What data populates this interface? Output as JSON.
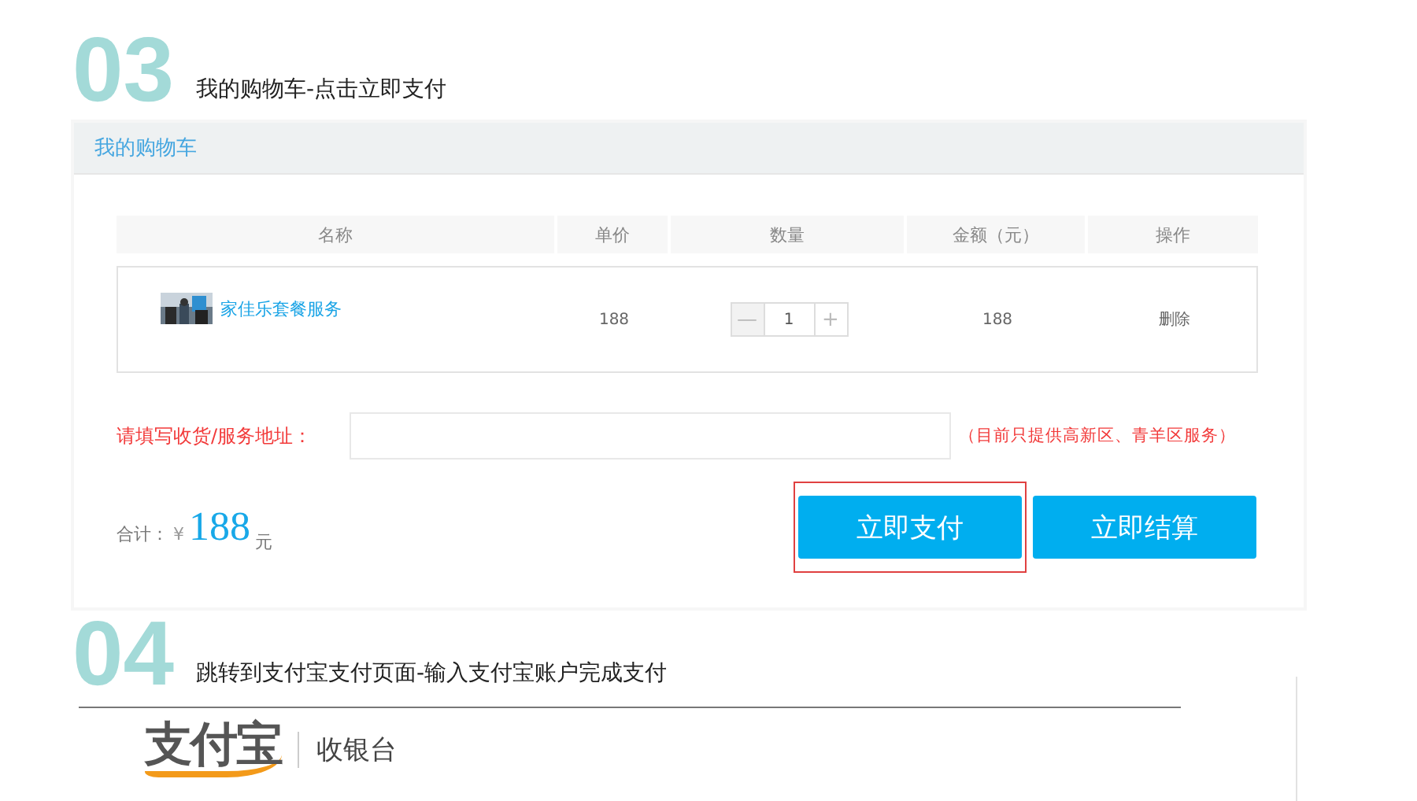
{
  "step_one": {
    "number": "03",
    "title": "我的购物车-点击立即支付"
  },
  "cart": {
    "title": "我的购物车",
    "columns": [
      "名称",
      "单价",
      "数量",
      "金额（元）",
      "操作"
    ],
    "items": [
      {
        "name": "家佳乐套餐服务",
        "kind": "picture",
        "price": "188",
        "minus": "—",
        "quantity": "1",
        "plus": "+",
        "amount": "188",
        "action": "删除"
      }
    ],
    "address": {
      "label": "请填写收货/服务地址：",
      "note": "（目前只提供高新区、青羊区服务）"
    },
    "total": {
      "label": "合计：",
      "currency": "¥",
      "value": "188",
      "unit": "元"
    },
    "buttons": [
      {
        "label": "立即支付",
        "highlighted": true
      },
      {
        "label": "立即结算",
        "highlighted": false
      }
    ]
  },
  "step_two": {
    "number": "04",
    "title": "跳转到支付宝支付页面-输入支付宝账户完成支付"
  },
  "cashier": {
    "logo": "支付宝",
    "title": "收银台"
  }
}
